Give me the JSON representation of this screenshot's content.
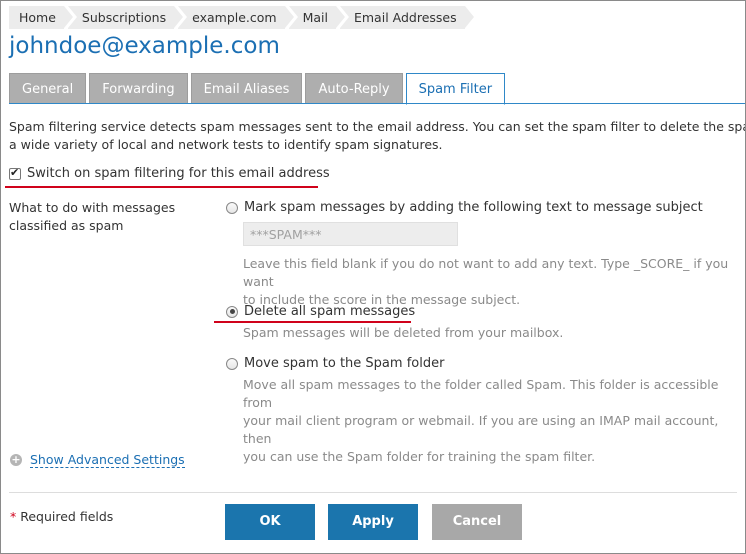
{
  "breadcrumb": [
    "Home",
    "Subscriptions",
    "example.com",
    "Mail",
    "Email Addresses"
  ],
  "page_title": "johndoe@example.com",
  "tabs": [
    {
      "label": "General",
      "active": false
    },
    {
      "label": "Forwarding",
      "active": false
    },
    {
      "label": "Email Aliases",
      "active": false
    },
    {
      "label": "Auto-Reply",
      "active": false
    },
    {
      "label": "Spam Filter",
      "active": true
    }
  ],
  "description": {
    "line1": "Spam filtering service detects spam messages sent to the email address. You can set the spam filter to delete the spam m",
    "line2": "a wide variety of local and network tests to identify spam signatures."
  },
  "switch_checkbox": {
    "label": "Switch on spam filtering for this email address",
    "checked": true
  },
  "action_label": {
    "line1": "What to do with messages",
    "line2": "classified as spam"
  },
  "options": {
    "mark": {
      "label": "Mark spam messages by adding the following text to message subject",
      "checked": false,
      "input_value": "***SPAM***",
      "hint_line1": "Leave this field blank if you do not want to add any text. Type _SCORE_ if you want",
      "hint_line2": "to include the score in the message subject."
    },
    "delete": {
      "label": "Delete all spam messages",
      "checked": true,
      "hint": "Spam messages will be deleted from your mailbox."
    },
    "move": {
      "label": "Move spam to the Spam folder",
      "checked": false,
      "hint_line1": "Move all spam messages to the folder called Spam. This folder is accessible from",
      "hint_line2": "your mail client program or webmail. If you are using an IMAP mail account, then",
      "hint_line3": "you can use the Spam folder for training the spam filter."
    }
  },
  "advanced_link": "Show Advanced Settings",
  "required_fields": {
    "star": "*",
    "text": " Required fields"
  },
  "buttons": {
    "ok": "OK",
    "apply": "Apply",
    "cancel": "Cancel"
  },
  "colors": {
    "accent": "#1b6fb3",
    "primary_button": "#1b75ad",
    "highlight_underline": "#d0021b"
  }
}
